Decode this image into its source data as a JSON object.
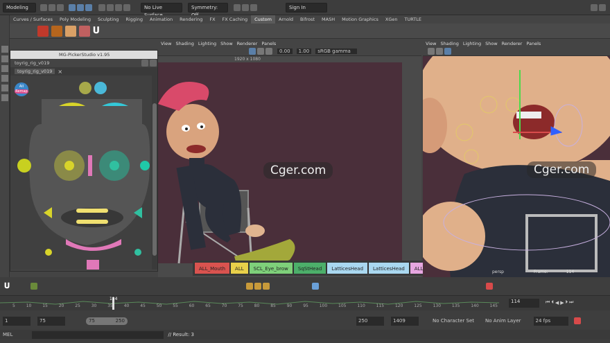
{
  "statusline": {
    "mode_select": "Modeling",
    "live_surface": "No Live Surface",
    "symmetry": "Symmetry: Off",
    "sign_in": "Sign In"
  },
  "shelf_tabs": [
    "Curves / Surfaces",
    "Poly Modeling",
    "Sculpting",
    "Rigging",
    "Animation",
    "Rendering",
    "FX",
    "FX Caching",
    "Custom",
    "Arnold",
    "Bifrost",
    "MASH",
    "Motion Graphics",
    "XGen",
    "TURTLE"
  ],
  "active_shelf_tab": "Custom",
  "viewport_menu": [
    "View",
    "Shading",
    "Lighting",
    "Show",
    "Renderer",
    "Panels"
  ],
  "viewport_toolbar": {
    "exposure": "0.00",
    "gamma": "1.00",
    "color_space": "sRGB gamma"
  },
  "viewport1": {
    "resolution": "1920 x 1080"
  },
  "viewport2": {
    "camera": "persp",
    "frame_label": "Frame:",
    "frame_value": "114"
  },
  "picker": {
    "title": "MG-PickerStudio v1.95",
    "rig_name": "toyrig_rig_v019",
    "tab_name": "toyrig_rig_v019",
    "all_button": "All",
    "remap_button": "Remap"
  },
  "watermark": "Cger.com",
  "pick_sets": [
    {
      "label": "ALL_Mouth",
      "color": "#d9534f"
    },
    {
      "label": "ALL",
      "color": "#e8d04a"
    },
    {
      "label": "SCL_Eye_brow",
      "color": "#7ed07a"
    },
    {
      "label": "SqStHead",
      "color": "#4caf6a"
    },
    {
      "label": "LatticesHead",
      "color": "#a9d8f0"
    },
    {
      "label": "LatticesHead",
      "color": "#a9d8f0"
    },
    {
      "label": "ALL_Eyes",
      "color": "#e6a6e0"
    }
  ],
  "timeline": {
    "ticks": [
      "5",
      "10",
      "15",
      "20",
      "25",
      "30",
      "35",
      "40",
      "45",
      "50",
      "55",
      "60",
      "65",
      "70",
      "75",
      "80",
      "85",
      "90",
      "95",
      "100",
      "105",
      "110",
      "115",
      "120",
      "125",
      "130",
      "135",
      "140",
      "145"
    ],
    "current_frame_marker": "114",
    "current_frame_field": "114"
  },
  "range": {
    "start": "1",
    "playback_start": "75",
    "slider_start": "75",
    "slider_end": "250",
    "playback_end": "250",
    "end": "1409",
    "character_set": "No Character Set",
    "anim_layer": "No Anim Layer",
    "fps": "24 fps"
  },
  "command": {
    "lang": "MEL",
    "result": "// Result: 3"
  }
}
